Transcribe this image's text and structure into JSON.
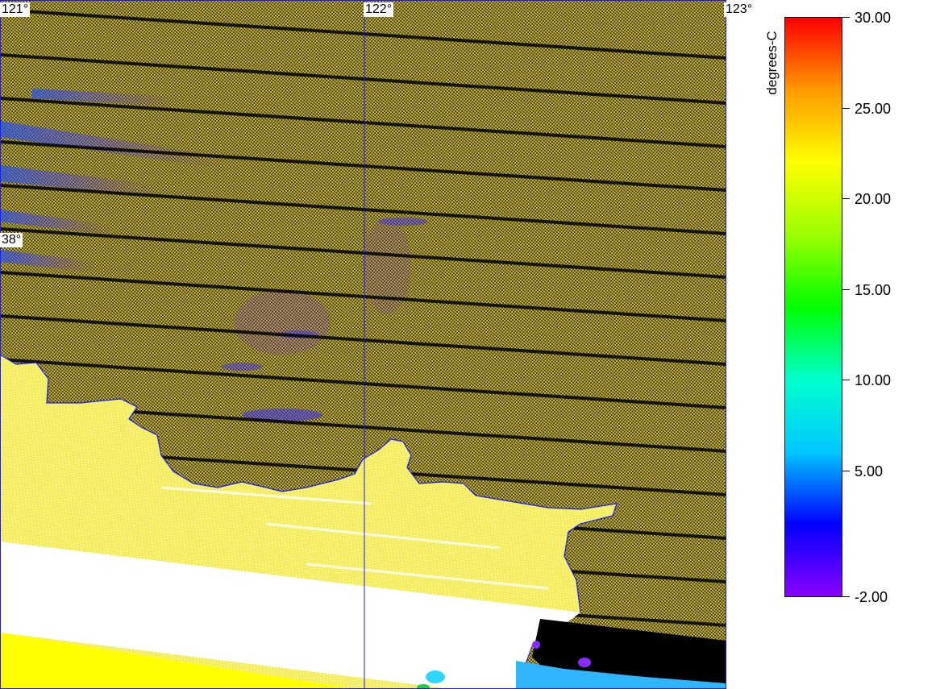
{
  "map": {
    "lon_labels": [
      "121°",
      "122°",
      "123°"
    ],
    "lat_labels": [
      "38°"
    ],
    "colors": {
      "sea_yellow": "#d4c23a",
      "stripe_dark": "#000000",
      "land_yellow": "#f5ef50",
      "bright_yellow": "#ffff00",
      "white": "#ffffff",
      "grid_line": "#1a1aff",
      "coast_line": "#1a1aff",
      "cold_blue": "#1f4fff",
      "cold_violet": "#7b2cff",
      "cyan": "#2fb6ff",
      "green": "#22cc44"
    }
  },
  "colorbar": {
    "units": "degrees-C",
    "tick_labels": [
      "30.00",
      "25.00",
      "20.00",
      "15.00",
      "10.00",
      "5.00",
      "-2.00"
    ],
    "min": -2.0,
    "max": 30.0,
    "stops": [
      "#ff0000",
      "#ff9a00",
      "#ffff00",
      "#9cff00",
      "#00ff00",
      "#00ffcc",
      "#00c8ff",
      "#0000ff",
      "#8a00ff"
    ]
  }
}
